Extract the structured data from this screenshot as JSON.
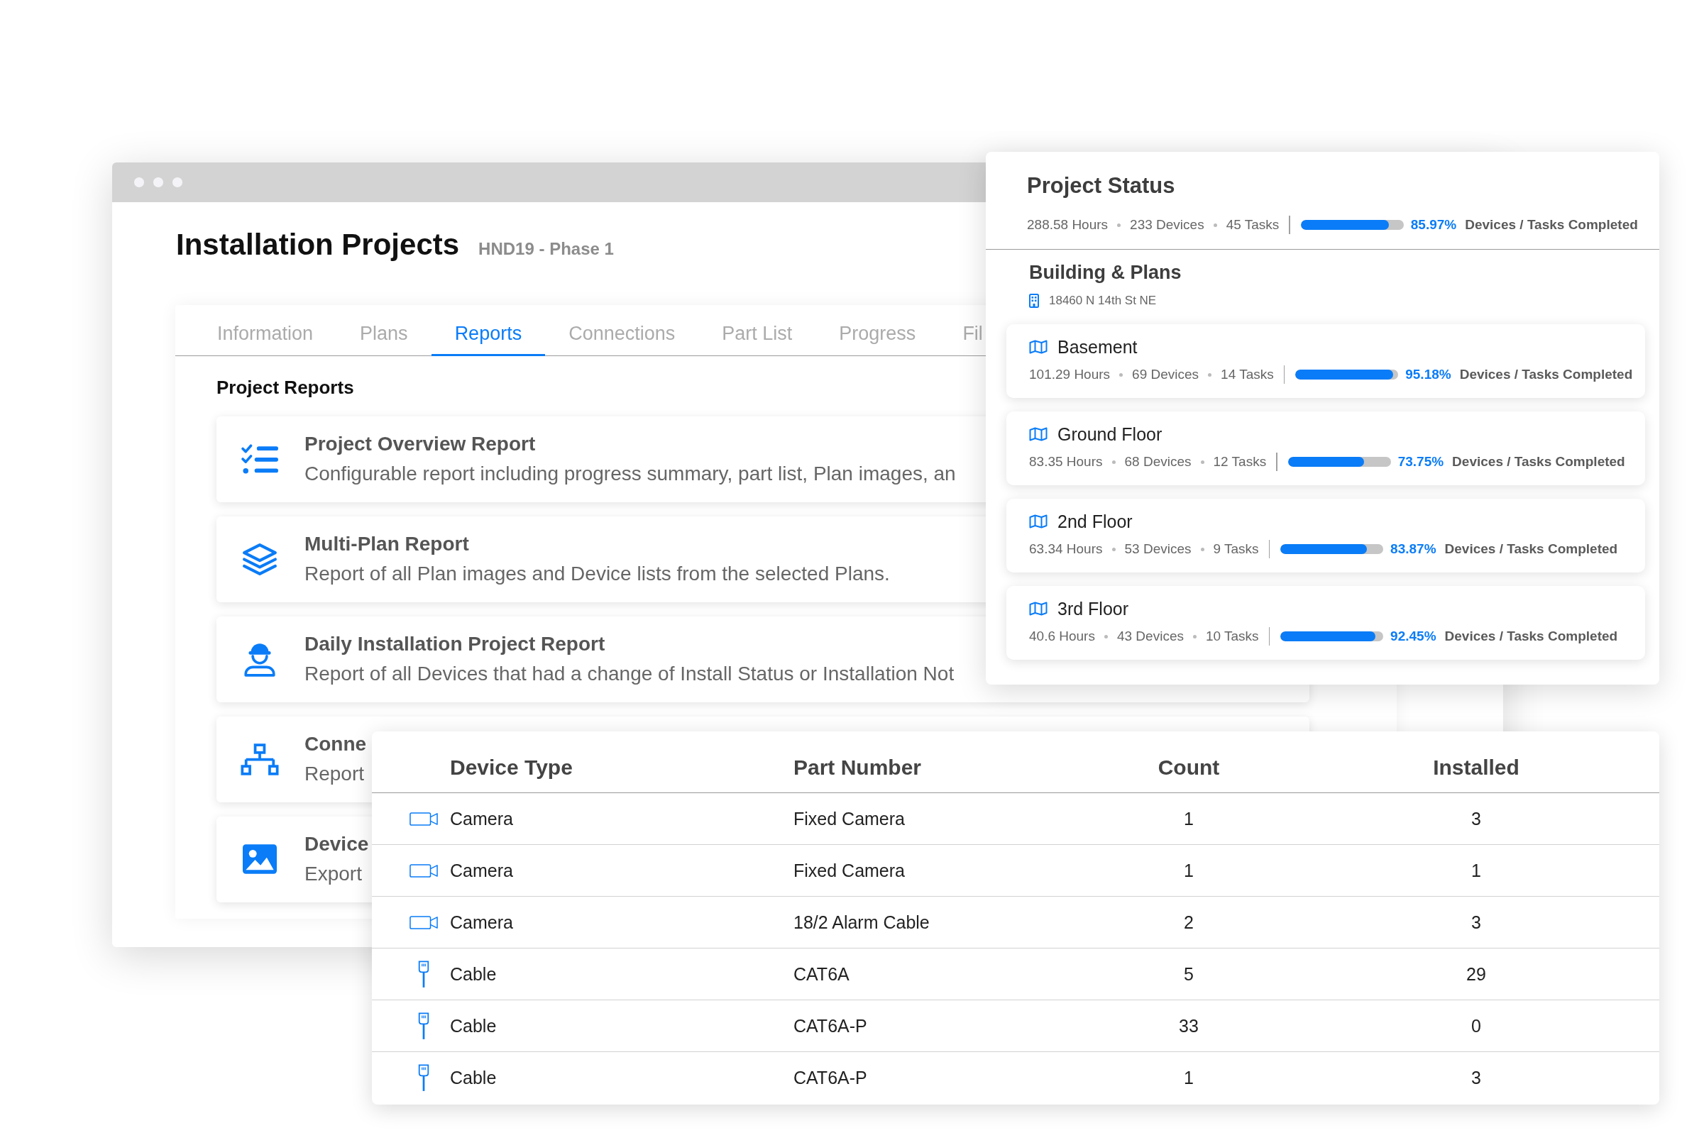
{
  "main_window": {
    "title": "Installation Projects",
    "subtitle": "HND19 - Phase 1",
    "tabs": [
      {
        "label": "Information",
        "selected": false
      },
      {
        "label": "Plans",
        "selected": false
      },
      {
        "label": "Reports",
        "selected": true
      },
      {
        "label": "Connections",
        "selected": false
      },
      {
        "label": "Part List",
        "selected": false
      },
      {
        "label": "Progress",
        "selected": false
      },
      {
        "label": "Fil",
        "selected": false
      }
    ],
    "section_title": "Project Reports",
    "reports": [
      {
        "kind": "checklist",
        "title": "Project Overview Report",
        "description": "Configurable report including progress summary, part list, Plan images, an"
      },
      {
        "kind": "layers",
        "title": "Multi-Plan Report",
        "description": "Report of all Plan images and Device lists from the selected Plans."
      },
      {
        "kind": "worker",
        "title": "Daily Installation Project Report",
        "description": "Report of all Devices that had a change of Install Status or Installation Not"
      },
      {
        "kind": "network",
        "title": "Conne",
        "description": "Report"
      },
      {
        "kind": "image",
        "title": "Device",
        "description": "Export"
      }
    ]
  },
  "project_status": {
    "title": "Project Status",
    "hours": "288.58 Hours",
    "devices": "233 Devices",
    "tasks": "45 Tasks",
    "level": 0.8597,
    "percent": "85.97%",
    "completion_label": "Devices / Tasks Completed"
  },
  "building": {
    "title": "Building & Plans",
    "address": "18460 N 14th St NE",
    "plans": [
      {
        "name": "Basement",
        "hours": "101.29 Hours",
        "devices": "69 Devices",
        "tasks": "14 Tasks",
        "level": 0.9518,
        "percent": "95.18%",
        "completion_label": "Devices / Tasks Completed"
      },
      {
        "name": "Ground Floor",
        "hours": "83.35 Hours",
        "devices": "68 Devices",
        "tasks": "12 Tasks",
        "level": 0.7375,
        "percent": "73.75%",
        "completion_label": "Devices / Tasks Completed"
      },
      {
        "name": "2nd Floor",
        "hours": "63.34 Hours",
        "devices": "53 Devices",
        "tasks": "9 Tasks",
        "level": 0.8387,
        "percent": "83.87%",
        "completion_label": "Devices / Tasks Completed"
      },
      {
        "name": "3rd Floor",
        "hours": "40.6 Hours",
        "devices": "43 Devices",
        "tasks": "10 Tasks",
        "level": 0.9245,
        "percent": "92.45%",
        "completion_label": "Devices / Tasks Completed"
      }
    ]
  },
  "device_table": {
    "columns": [
      "Device Type",
      "Part Number",
      "Count",
      "Installed"
    ],
    "rows": [
      {
        "kind": "camera",
        "device_type": "Camera",
        "part_number": "Fixed Camera",
        "count": "1",
        "installed": "3"
      },
      {
        "kind": "camera",
        "device_type": "Camera",
        "part_number": "Fixed Camera",
        "count": "1",
        "installed": "1"
      },
      {
        "kind": "camera",
        "device_type": "Camera",
        "part_number": "18/2 Alarm Cable",
        "count": "2",
        "installed": "3"
      },
      {
        "kind": "cable",
        "device_type": "Cable",
        "part_number": "CAT6A",
        "count": "5",
        "installed": "29"
      },
      {
        "kind": "cable",
        "device_type": "Cable",
        "part_number": "CAT6A-P",
        "count": "33",
        "installed": "0"
      },
      {
        "kind": "cable",
        "device_type": "Cable",
        "part_number": "CAT6A-P",
        "count": "1",
        "installed": "3"
      }
    ]
  }
}
